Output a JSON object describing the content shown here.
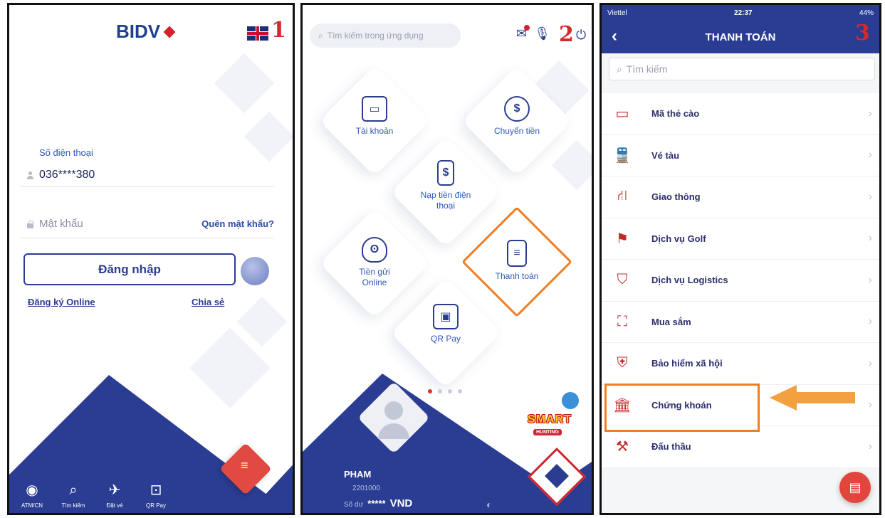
{
  "screen1": {
    "step": "1",
    "logo": "BIDV",
    "phone_label": "Số điện thoại",
    "phone_value": "036****380",
    "password_placeholder": "Mật khẩu",
    "forgot_password": "Quên mật khẩu?",
    "login_button": "Đăng nhập",
    "register_online": "Đăng ký Online",
    "share": "Chia sẻ",
    "nav": [
      {
        "label": "ATM/CN",
        "icon": "location-pin-icon"
      },
      {
        "label": "Tìm kiếm",
        "icon": "search-icon"
      },
      {
        "label": "Đặt vé",
        "icon": "plane-icon"
      },
      {
        "label": "QR Pay",
        "icon": "qr-scan-icon"
      }
    ]
  },
  "screen2": {
    "step": "2",
    "search_placeholder": "Tìm kiếm trong ứng dụng",
    "tiles": {
      "account": "Tài khoản",
      "transfer": "Chuyển tiền",
      "topup": "Nạp tiền điện thoại",
      "savings": "Tiền gửi Online",
      "payment": "Thanh toán",
      "qrpay": "QR Pay"
    },
    "account_name": "PHAM",
    "account_number": "2201000",
    "balance_label": "Số dư",
    "balance_masked": "*****",
    "currency": "VND",
    "badge": "SMART",
    "badge_sub": "HUNTING"
  },
  "screen3": {
    "step": "3",
    "carrier": "Viettel",
    "time": "22:37",
    "battery": "44%",
    "title": "THANH TOÁN",
    "search_placeholder": "Tìm kiếm",
    "items": [
      {
        "label": "Mã thẻ cào",
        "icon": "card-icon"
      },
      {
        "label": "Vé tàu",
        "icon": "train-icon"
      },
      {
        "label": "Giao thông",
        "icon": "road-icon"
      },
      {
        "label": "Dịch vụ Golf",
        "icon": "golf-flag-icon"
      },
      {
        "label": "Dịch vụ Logistics",
        "icon": "logistics-icon"
      },
      {
        "label": "Mua sắm",
        "icon": "shopping-bag-icon"
      },
      {
        "label": "Bảo hiểm xã hội",
        "icon": "shield-icon"
      },
      {
        "label": "Chứng khoán",
        "icon": "bank-building-icon"
      },
      {
        "label": "Đấu thầu",
        "icon": "gavel-icon"
      }
    ]
  },
  "colors": {
    "brand_blue": "#2a3d93",
    "brand_red": "#d3232a",
    "highlight_orange": "#ef7d22"
  }
}
